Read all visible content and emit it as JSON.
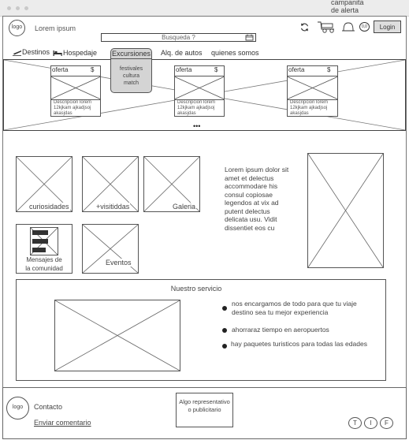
{
  "window": {
    "alert_label": "campanita\nde alerta"
  },
  "header": {
    "logo": "logo",
    "site_name": "Lorem ipsum",
    "search_placeholder": "Busqueda ?",
    "login_label": "Login",
    "counter_badge": "0,0"
  },
  "nav": {
    "items": [
      {
        "label": "Destinos"
      },
      {
        "label": "Hospedaje"
      },
      {
        "label": "Excursiones"
      },
      {
        "label": "Alq. de autos"
      },
      {
        "label": "quienes somos"
      }
    ],
    "dropdown_text": "festivales\ncultura\nmatch"
  },
  "carousel": {
    "cards": [
      {
        "title": "oferta",
        "currency": "$",
        "desc": "Descripcion lorem 12kjkam ajkadjsoj akasjdas"
      },
      {
        "title": "oferta",
        "currency": "$",
        "desc": "Descripcion lorem 12kjkam ajkadjsoj akasjdas"
      },
      {
        "title": "oferta",
        "currency": "$",
        "desc": "Descripcion lorem 12kjkam ajkadjsoj akasjdas"
      }
    ],
    "dots": "•••"
  },
  "tiles": {
    "curiosidades": "curiosidades",
    "visitadas": "+visitiddas",
    "galeria": "Galeria",
    "mensajes": "Mensajes de\nla comunidad",
    "eventos": "Eventos"
  },
  "lorem_paragraph": "Lorem ipsum dolor sit amet et delectus accommodare his consul copiosae legendos at vix ad putent delectus delicata usu. Vidit dissentiet eos cu",
  "service": {
    "title": "Nuestro servicio",
    "bullets": [
      "nos encargamos de todo para que tu viaje destino sea tu mejor experiencia",
      "ahorraraz tiempo en aeropuertos",
      "hay paquetes turisticos para todas las edades"
    ]
  },
  "footer": {
    "logo": "logo",
    "contact": "Contacto",
    "comment_link": "Enviar comentario",
    "ad_text": "Algo representativo o publicitario",
    "social": [
      "T",
      "I",
      "F"
    ]
  }
}
